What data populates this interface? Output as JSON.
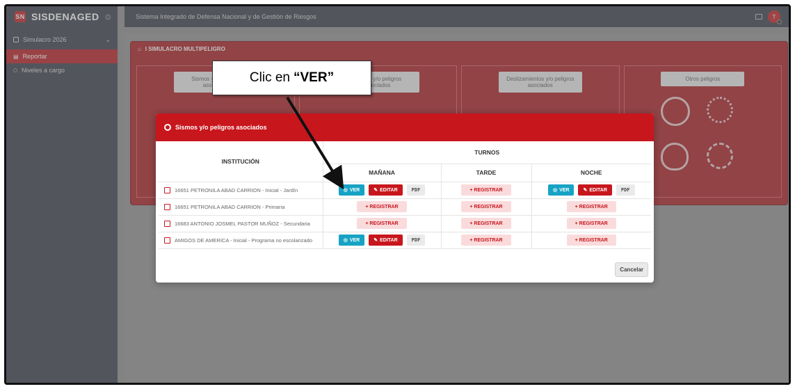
{
  "app": {
    "brand": "SISDENAGED",
    "logo_text": "SN"
  },
  "topbar": {
    "title": "Sistema Integrado de Defensa Nacional y de Gestión de Riesgos",
    "avatar_initial": "T"
  },
  "sidebar": {
    "group_label": "Simulacro 2026",
    "items": [
      {
        "label": "Reportar",
        "active": true
      },
      {
        "label": "Niveles a cargo",
        "active": false
      }
    ]
  },
  "panel": {
    "title": "I SIMULACRO MULTIPELIGRO",
    "cards": [
      {
        "label": "Sismos y/o peligros asociados"
      },
      {
        "label": "Lluvias y/o peligros asociados"
      },
      {
        "label": "Deslizamientos y/o peligros asociados"
      },
      {
        "label": "Otros peligros"
      }
    ]
  },
  "modal": {
    "title": "Sismos y/o peligros asociados",
    "col_institucion": "INSTITUCIÓN",
    "col_turnos": "TURNOS",
    "shifts": [
      "MAÑANA",
      "TARDE",
      "NOCHE"
    ],
    "rows": [
      {
        "institution": "16651 PETRONILA ABAD CARRION - Inicial - Jardín",
        "manana": "done",
        "tarde": "register",
        "noche": "done"
      },
      {
        "institution": "16651 PETRONILA ABAD CARRION - Primaria",
        "manana": "register",
        "tarde": "register",
        "noche": "register"
      },
      {
        "institution": "16683 ANTONIO JOSMEL PASTOR MUÑOZ - Secundaria",
        "manana": "register",
        "tarde": "register",
        "noche": "register"
      },
      {
        "institution": "AMIGOS DE AMERICA - Inicial - Programa no escolarizado",
        "manana": "done",
        "tarde": "register",
        "noche": "register"
      }
    ],
    "btn_ver": "VER",
    "btn_editar": "EDITAR",
    "btn_pdf": "PDF",
    "btn_registrar": "+ REGISTRAR",
    "btn_cancelar": "Cancelar"
  },
  "callout": {
    "text_prefix": "Clic en",
    "text_bold": "“VER”"
  },
  "colors": {
    "brand_red": "#c8161d",
    "ver_cyan": "#17a3c4",
    "sidebar_bg": "#363a48"
  }
}
